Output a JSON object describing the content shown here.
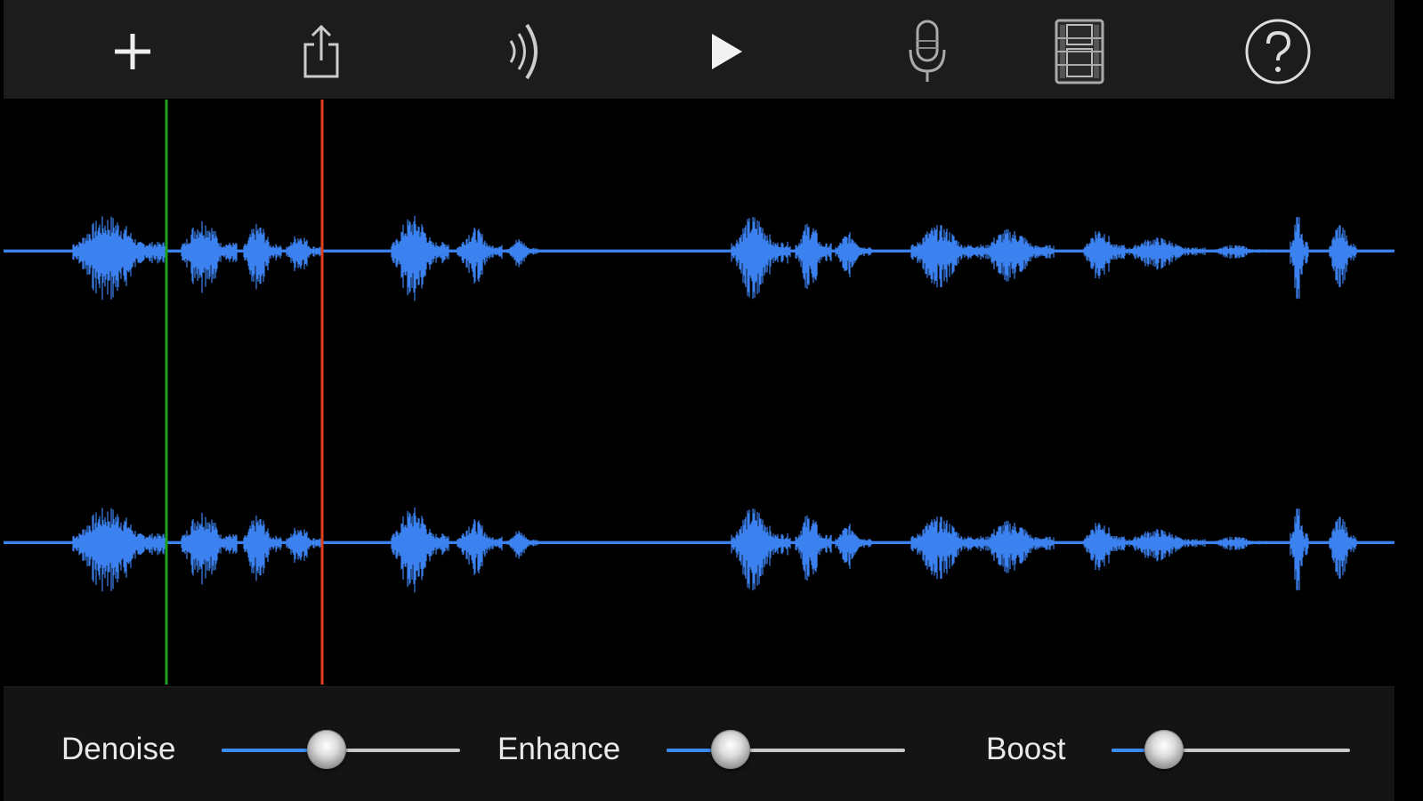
{
  "toolbar": {
    "buttons": [
      {
        "name": "plus-icon"
      },
      {
        "name": "share-icon"
      },
      {
        "name": "sound-waves-icon"
      },
      {
        "name": "play-icon"
      },
      {
        "name": "microphone-icon"
      },
      {
        "name": "film-icon"
      },
      {
        "name": "help-icon"
      }
    ]
  },
  "waveform": {
    "color": "#3b82f0",
    "start_marker_color": "#1fa31f",
    "end_marker_color": "#e2401c",
    "channels": 2
  },
  "controls": {
    "denoise": {
      "label": "Denoise",
      "value": 0.44
    },
    "enhance": {
      "label": "Enhance",
      "value": 0.27
    },
    "boost": {
      "label": "Boost",
      "value": 0.22
    },
    "track_fill_color": "#3b8cf0",
    "track_color": "#c9c9c9"
  }
}
